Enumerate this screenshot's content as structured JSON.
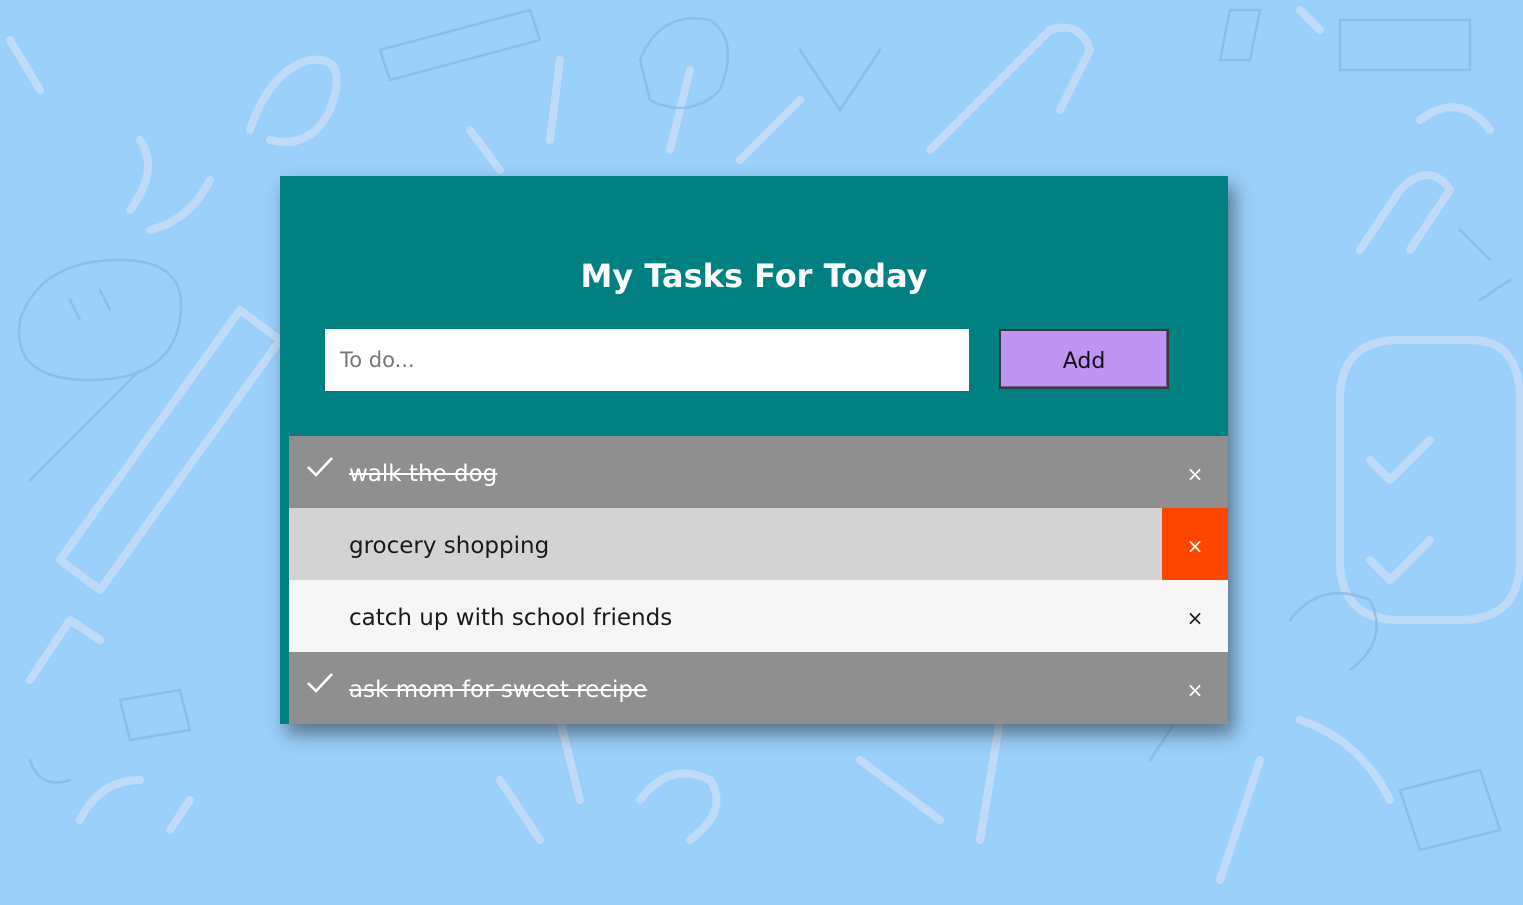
{
  "app": {
    "title": "My Tasks For Today",
    "input": {
      "placeholder": "To do...",
      "value": ""
    },
    "add_label": "Add",
    "tasks": [
      {
        "text": "walk the dog",
        "done": true,
        "close": "×"
      },
      {
        "text": "grocery shopping",
        "done": false,
        "close": "×"
      },
      {
        "text": "catch up with school friends",
        "done": false,
        "close": "×"
      },
      {
        "text": "ask mom for sweet recipe",
        "done": true,
        "close": "×"
      }
    ],
    "check_icon": "checkmark-icon"
  },
  "colors": {
    "background": "#9bd0fb",
    "header": "#008080",
    "add_button": "#bf94f2",
    "done_row": "#8f8f8f",
    "hover_row": "#d3d3d3",
    "row": "#f6f6f6",
    "close_active": "#ff4500"
  }
}
